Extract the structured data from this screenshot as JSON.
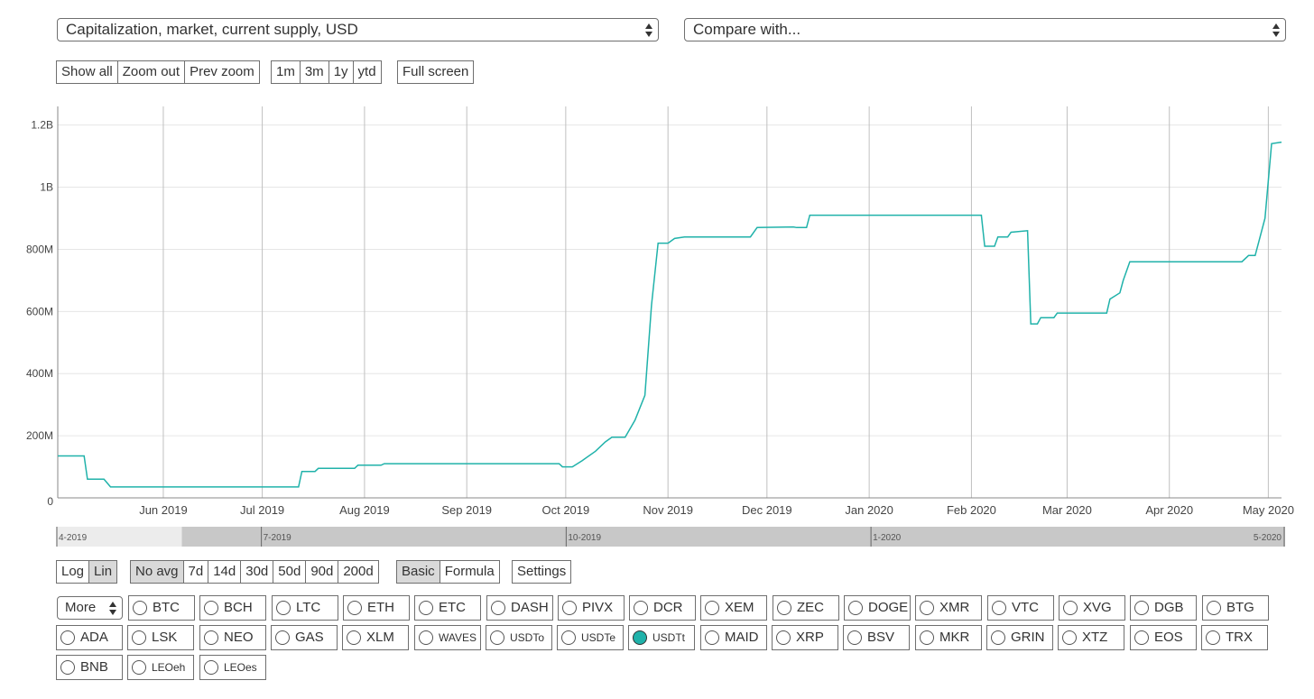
{
  "metric_select": {
    "value": "Capitalization, market, current supply, USD"
  },
  "compare_select": {
    "value": "Compare with..."
  },
  "zoom_controls": [
    "Show all",
    "Zoom out",
    "Prev zoom"
  ],
  "range_controls": [
    "1m",
    "3m",
    "1y",
    "ytd"
  ],
  "fullscreen_label": "Full screen",
  "scale_controls": {
    "items": [
      "Log",
      "Lin"
    ],
    "active": "Lin"
  },
  "avg_controls": {
    "items": [
      "No avg",
      "7d",
      "14d",
      "30d",
      "50d",
      "90d",
      "200d"
    ],
    "active": "No avg"
  },
  "mode_controls": {
    "items": [
      "Basic",
      "Formula"
    ],
    "active": "Basic"
  },
  "settings_label": "Settings",
  "more_label": "More",
  "coins": [
    "BTC",
    "BCH",
    "LTC",
    "ETH",
    "ETC",
    "DASH",
    "PIVX",
    "DCR",
    "XEM",
    "ZEC",
    "DOGE",
    "XMR",
    "VTC",
    "XVG",
    "DGB",
    "BTG",
    "ADA",
    "LSK",
    "NEO",
    "GAS",
    "XLM",
    "WAVES",
    "USDTo",
    "USDTe",
    "USDTt",
    "MAID",
    "XRP",
    "BSV",
    "MKR",
    "GRIN",
    "XTZ",
    "EOS",
    "TRX",
    "BNB",
    "LEOeh",
    "LEOes"
  ],
  "selected_coin": "USDTt",
  "colors": {
    "line": "#20b2aa",
    "grid": "#e6e6e6",
    "vgrid": "#c0c0c0",
    "selected_radio": "#20b2aa"
  },
  "chart_data": {
    "type": "line",
    "series": [
      {
        "name": "",
        "color": "#20b2aa",
        "points": [
          [
            "2019-04-30",
            135
          ],
          [
            "2019-05-08",
            135
          ],
          [
            "2019-05-09",
            60
          ],
          [
            "2019-05-14",
            60
          ],
          [
            "2019-05-16",
            35
          ],
          [
            "2019-07-01",
            35
          ],
          [
            "2019-07-12",
            35
          ],
          [
            "2019-07-13",
            85
          ],
          [
            "2019-07-17",
            85
          ],
          [
            "2019-07-18",
            95
          ],
          [
            "2019-07-29",
            95
          ],
          [
            "2019-07-30",
            105
          ],
          [
            "2019-08-06",
            105
          ],
          [
            "2019-08-07",
            110
          ],
          [
            "2019-09-29",
            110
          ],
          [
            "2019-09-30",
            100
          ],
          [
            "2019-10-03",
            100
          ],
          [
            "2019-10-06",
            120
          ],
          [
            "2019-10-10",
            150
          ],
          [
            "2019-10-13",
            180
          ],
          [
            "2019-10-15",
            195
          ],
          [
            "2019-10-19",
            195
          ],
          [
            "2019-10-22",
            250
          ],
          [
            "2019-10-25",
            330
          ],
          [
            "2019-10-27",
            620
          ],
          [
            "2019-10-29",
            820
          ],
          [
            "2019-11-01",
            820
          ],
          [
            "2019-11-03",
            835
          ],
          [
            "2019-11-06",
            840
          ],
          [
            "2019-11-26",
            840
          ],
          [
            "2019-11-28",
            870
          ],
          [
            "2019-12-09",
            872
          ],
          [
            "2019-12-10",
            870
          ],
          [
            "2019-12-13",
            870
          ],
          [
            "2019-12-14",
            910
          ],
          [
            "2019-12-31",
            910
          ],
          [
            "2020-01-05",
            910
          ],
          [
            "2020-02-01",
            910
          ],
          [
            "2020-02-04",
            910
          ],
          [
            "2020-02-05",
            810
          ],
          [
            "2020-02-08",
            810
          ],
          [
            "2020-02-09",
            840
          ],
          [
            "2020-02-12",
            840
          ],
          [
            "2020-02-13",
            855
          ],
          [
            "2020-02-18",
            860
          ],
          [
            "2020-02-19",
            560
          ],
          [
            "2020-02-21",
            560
          ],
          [
            "2020-02-22",
            580
          ],
          [
            "2020-02-26",
            580
          ],
          [
            "2020-02-27",
            595
          ],
          [
            "2020-03-13",
            595
          ],
          [
            "2020-03-14",
            640
          ],
          [
            "2020-03-17",
            660
          ],
          [
            "2020-03-18",
            700
          ],
          [
            "2020-03-20",
            760
          ],
          [
            "2020-04-23",
            760
          ],
          [
            "2020-04-25",
            780
          ],
          [
            "2020-04-27",
            780
          ],
          [
            "2020-04-30",
            900
          ],
          [
            "2020-05-02",
            1140
          ],
          [
            "2020-05-05",
            1145
          ]
        ]
      }
    ],
    "ylim": [
      0,
      1260
    ],
    "yticks": [
      0,
      200,
      400,
      600,
      800,
      1000,
      1200
    ],
    "ytick_labels": [
      "0",
      "200M",
      "400M",
      "600M",
      "800M",
      "1B",
      "1.2B"
    ],
    "xlim": [
      "2019-04-30",
      "2020-05-05"
    ],
    "xticks": [
      "2019-06-01",
      "2019-07-01",
      "2019-08-01",
      "2019-09-01",
      "2019-10-01",
      "2019-11-01",
      "2019-12-01",
      "2020-01-01",
      "2020-02-01",
      "2020-03-01",
      "2020-04-01",
      "2020-05-01"
    ],
    "xtick_labels": [
      "Jun 2019",
      "Jul 2019",
      "Aug 2019",
      "Sep 2019",
      "Oct 2019",
      "Nov 2019",
      "Dec 2019",
      "Jan 2020",
      "Feb 2020",
      "Mar 2020",
      "Apr 2020",
      "May 2020"
    ],
    "navigator": {
      "xlim": [
        "2019-04-30",
        "2020-05-05"
      ],
      "selected": [
        "2019-06-07",
        "2020-05-05"
      ],
      "ticks": [
        "2019-04-01",
        "2019-07-01",
        "2019-10-01",
        "2020-01-01",
        "2020-05-01"
      ],
      "tick_labels": [
        "4-2019",
        "7-2019",
        "10-2019",
        "1-2020",
        "5-2020"
      ]
    },
    "grid": true,
    "legend": "none"
  }
}
